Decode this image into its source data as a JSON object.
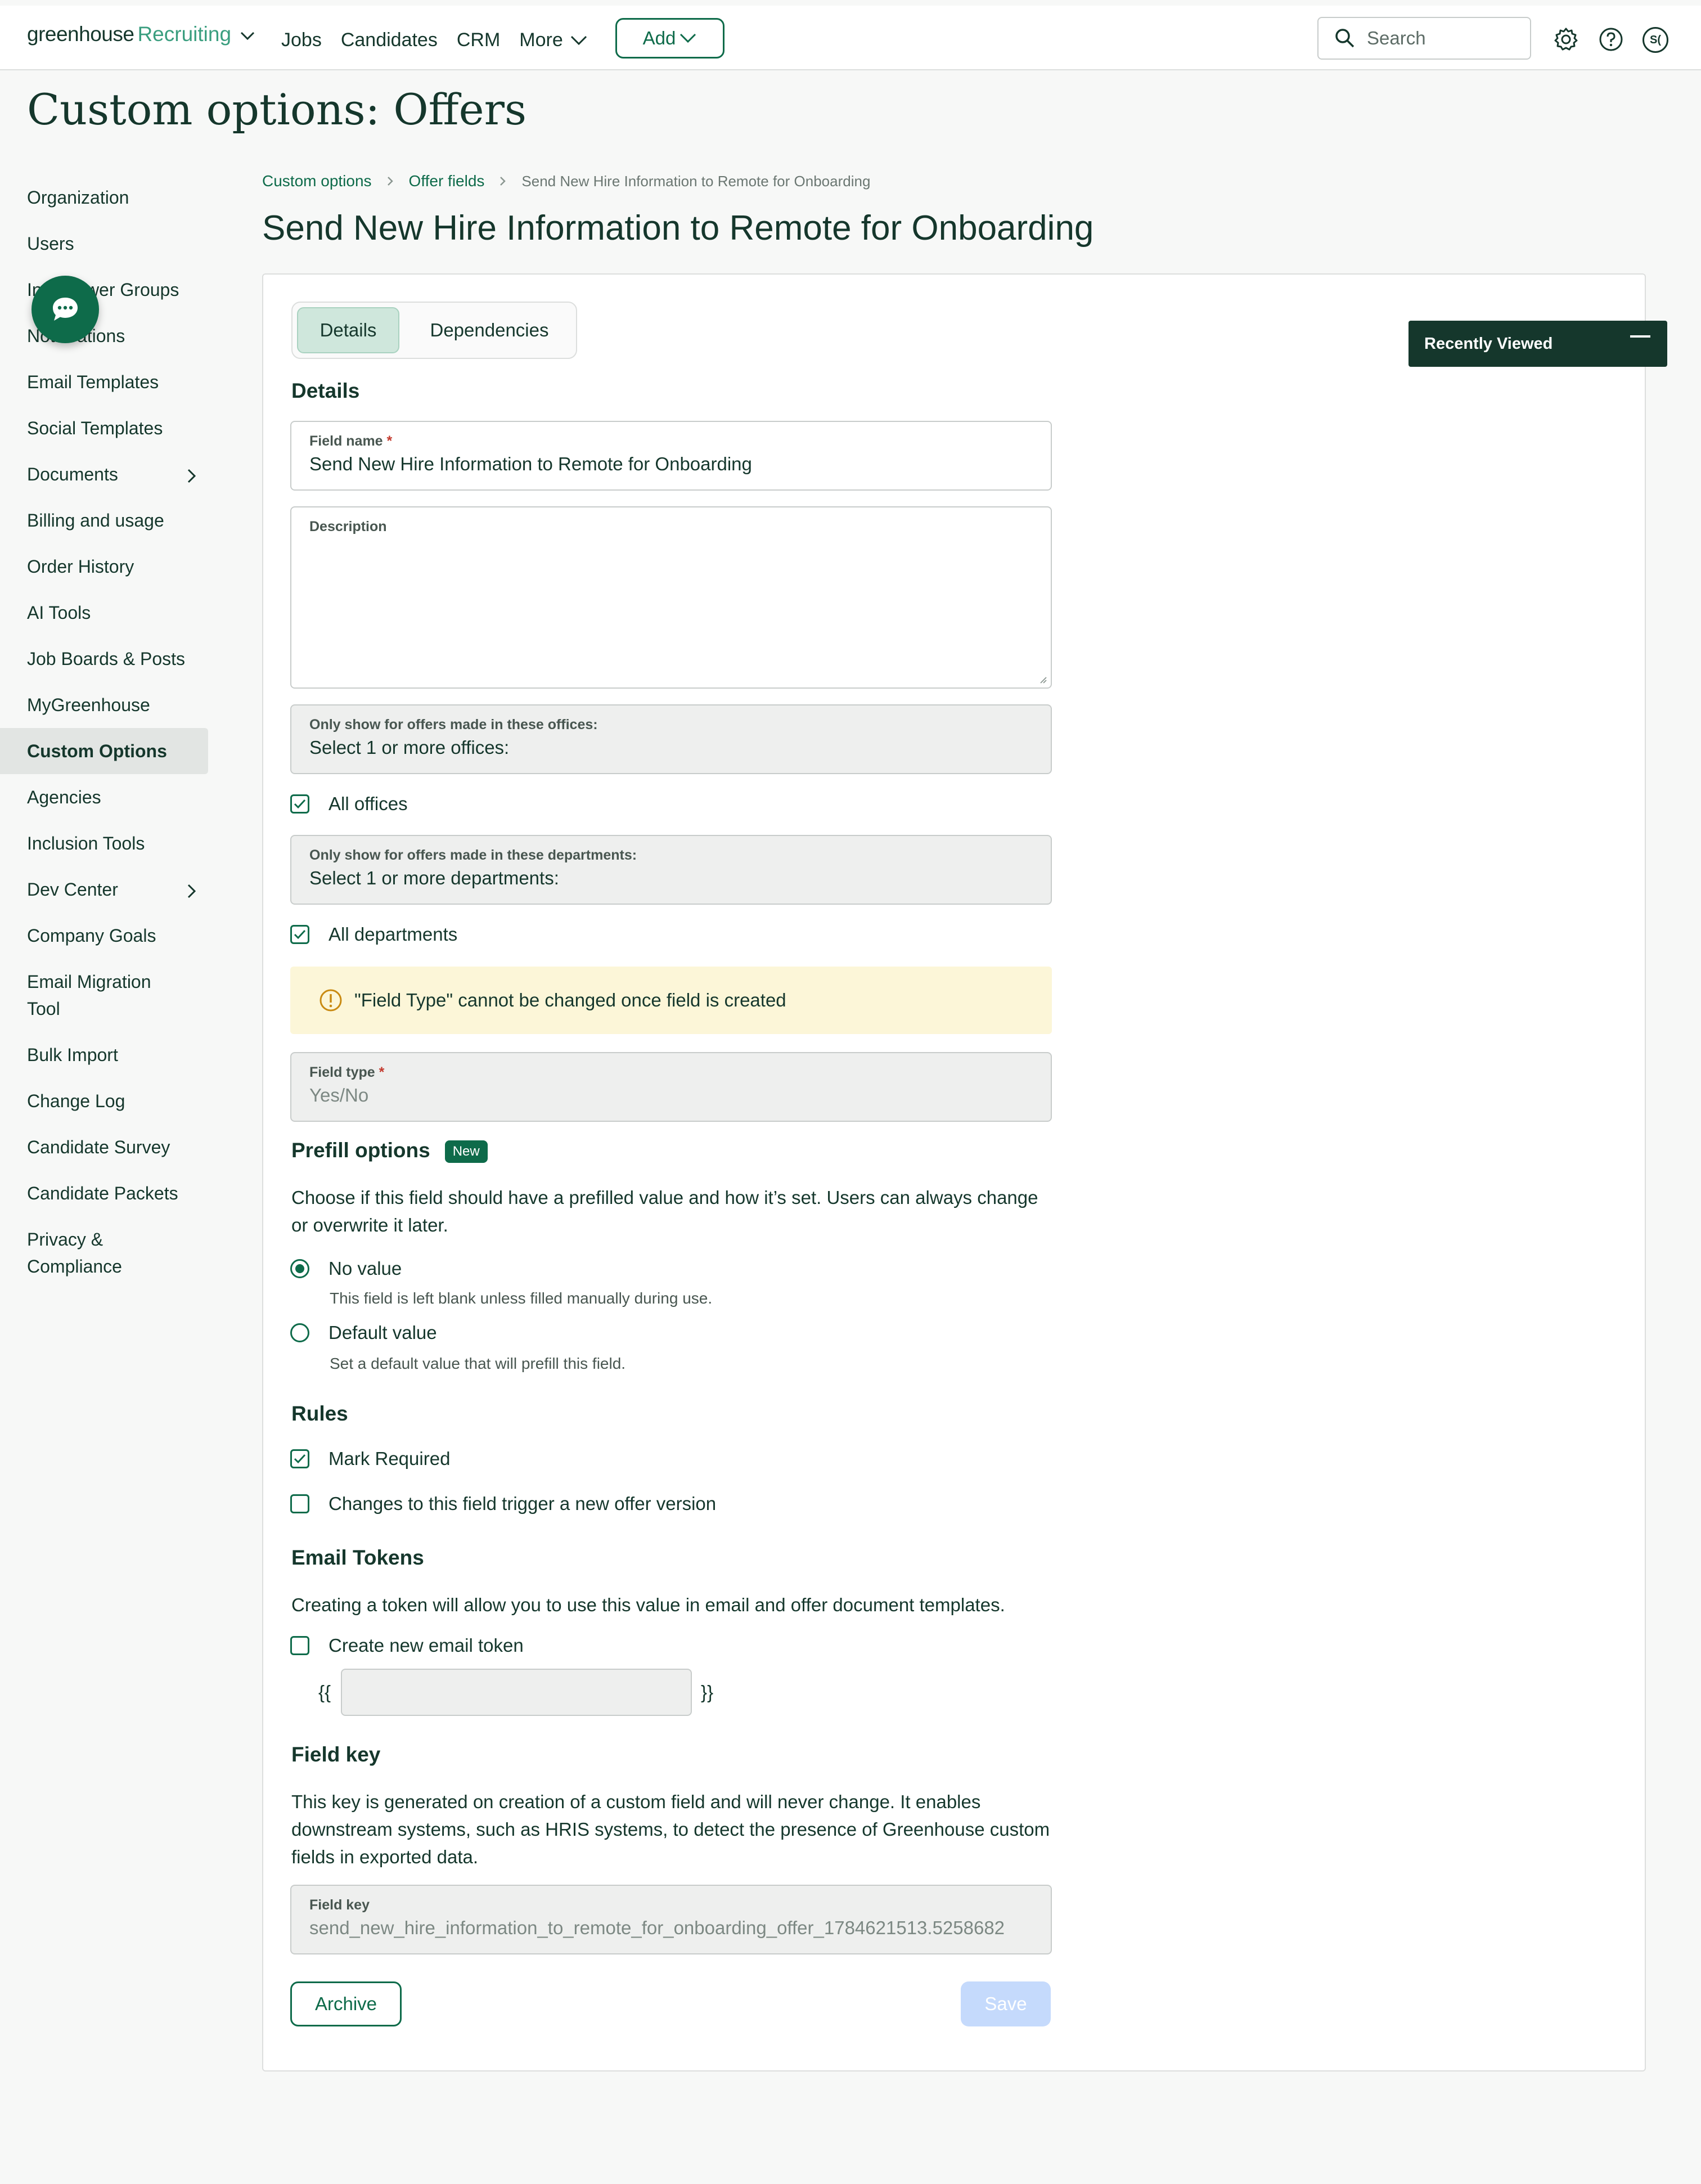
{
  "topnav": {
    "logo_main": "greenhouse",
    "logo_product": "Recruiting",
    "links": [
      "Jobs",
      "Candidates",
      "CRM",
      "More"
    ],
    "add_label": "Add",
    "search_placeholder": "Search",
    "avatar_initials": "S("
  },
  "page_title": "Custom options: Offers",
  "sidebar": {
    "items": [
      "Organization",
      "Users",
      "Interviewer Groups",
      "Notifications",
      "Email Templates",
      "Social Templates",
      "Documents",
      "Billing and usage",
      "Order History",
      "AI Tools",
      "Job Boards & Posts",
      "MyGreenhouse",
      "Custom Options",
      "Agencies",
      "Inclusion Tools",
      "Dev Center",
      "Company Goals",
      "Email Migration Tool",
      "Bulk Import",
      "Change Log",
      "Candidate Survey",
      "Candidate Packets",
      "Privacy & Compliance"
    ],
    "active": "Custom Options"
  },
  "breadcrumb": {
    "level1": "Custom options",
    "level2": "Offer fields",
    "current": "Send New Hire Information to Remote for Onboarding"
  },
  "header_title": "Send New Hire Information to Remote for Onboarding",
  "tabs": {
    "details": "Details",
    "dependencies": "Dependencies"
  },
  "details": {
    "heading": "Details",
    "field_name_label": "Field name",
    "required_mark": "*",
    "field_name_value": "Send New Hire Information to Remote for Onboarding",
    "description_label": "Description",
    "offices_label": "Only show for offers made in these offices:",
    "offices_placeholder": "Select 1 or more offices:",
    "all_offices_label": "All offices",
    "all_offices_checked": true,
    "departments_label": "Only show for offers made in these departments:",
    "departments_placeholder": "Select 1 or more departments:",
    "all_departments_label": "All departments",
    "all_departments_checked": true,
    "warning_text": "\"Field Type\" cannot be changed once field is created",
    "field_type_label": "Field type",
    "field_type_value": "Yes/No"
  },
  "prefill": {
    "heading": "Prefill options",
    "badge": "New",
    "description": "Choose if this field should have a prefilled value and how it’s set. Users can always change or overwrite it later.",
    "options": [
      {
        "label": "No value",
        "help": "This field is left blank unless filled manually during use.",
        "selected": true
      },
      {
        "label": "Default value",
        "help": "Set a default value that will prefill this field.",
        "selected": false
      }
    ]
  },
  "rules": {
    "heading": "Rules",
    "mark_required_label": "Mark Required",
    "mark_required_checked": true,
    "new_version_label": "Changes to this field trigger a new offer version",
    "new_version_checked": false
  },
  "email_tokens": {
    "heading": "Email Tokens",
    "description": "Creating a token will allow you to use this value in email and offer document templates.",
    "create_label": "Create new email token",
    "create_checked": false,
    "open_braces": "{{",
    "close_braces": "}}"
  },
  "field_key": {
    "heading": "Field key",
    "description": "This key is generated on creation of a custom field and will never change. It enables downstream systems, such as HRIS systems, to detect the presence of Greenhouse custom fields in exported data.",
    "label": "Field key",
    "value": "send_new_hire_information_to_remote_for_onboarding_offer_1784621513.5258682"
  },
  "actions": {
    "archive": "Archive",
    "save": "Save"
  },
  "recently_viewed": {
    "title": "Recently Viewed"
  },
  "colors": {
    "brand": "#0e6b4a",
    "warning_bg": "#fcf6d8",
    "save_disabled": "#c5dafc"
  }
}
